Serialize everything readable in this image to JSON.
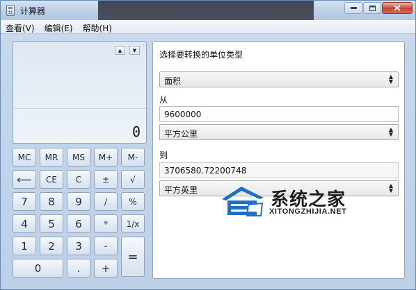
{
  "window": {
    "title": "计算器",
    "controls": {
      "minimize": "▭",
      "maximize": "▫",
      "close": "✕"
    }
  },
  "menu": [
    {
      "label": "查看(V)"
    },
    {
      "label": "编辑(E)"
    },
    {
      "label": "帮助(H)"
    }
  ],
  "display": {
    "value": "0",
    "scroll_up": "▲",
    "scroll_down": "▼"
  },
  "keys": {
    "mc": "MC",
    "mr": "MR",
    "ms": "MS",
    "mplus": "M+",
    "mminus": "M-",
    "back": "⟵",
    "ce": "CE",
    "c": "C",
    "plusminus": "±",
    "sqrt": "√",
    "n7": "7",
    "n8": "8",
    "n9": "9",
    "div": "/",
    "percent": "%",
    "n4": "4",
    "n5": "5",
    "n6": "6",
    "mul": "*",
    "recip": "1/x",
    "n1": "1",
    "n2": "2",
    "n3": "3",
    "sub": "-",
    "eq": "=",
    "n0": "0",
    "dot": ".",
    "add": "+"
  },
  "converter": {
    "heading": "选择要转换的单位类型",
    "type_value": "面积",
    "from_label": "从",
    "from_value": "9600000",
    "from_unit": "平方公里",
    "to_label": "到",
    "to_value": "3706580.72200748",
    "to_unit": "平方英里",
    "select_arrow": "▲▼"
  },
  "watermark": {
    "text": "系统之家",
    "sub": "XITONGZHIJIA.NET"
  },
  "colors": {
    "window_bg": "#c9d9ec",
    "watermark_blue": "#1f6fc6"
  }
}
